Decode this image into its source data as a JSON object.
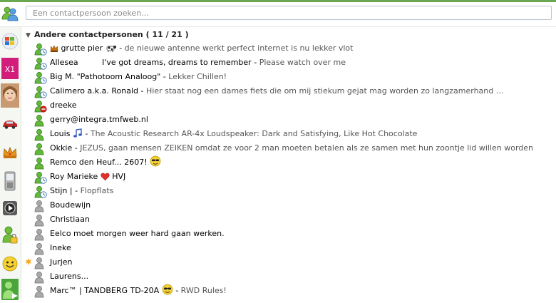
{
  "search": {
    "placeholder": "Een contactpersoon zoeken..."
  },
  "group": {
    "title": "Andere contactpersonen",
    "count": "( 11 / 21 )"
  },
  "sidebar": {
    "items": [
      "windows-logo-icon",
      "x1-icon",
      "user-photo",
      "car-icon",
      "crown-icon",
      "phone-icon",
      "media-play-icon",
      "buddy-lock-icon",
      "smiley-icon",
      "buddy-video-icon"
    ]
  },
  "contacts": [
    {
      "status": "away",
      "pre_icon": "crown",
      "name": "grutte pier",
      "post_icon": "cow",
      "sep": " - ",
      "msg": "de nieuwe antenne werkt perfect internet is nu lekker vlot"
    },
    {
      "status": "away",
      "name": "Allesea",
      "gap": true,
      "name2": "I've got dreams, dreams to remember",
      "sep": " - ",
      "msg": "Please watch over me"
    },
    {
      "status": "away",
      "name": "Big M. \"Pathotoom Analoog\"",
      "sep": " - ",
      "msg": "Lekker Chillen!"
    },
    {
      "status": "away",
      "name": "Calimero a.k.a. Ronald",
      "sep": " - ",
      "msg": "Hier staat nog een dames fiets die om mij stiekum gejat mag worden zo langzamerhand ..."
    },
    {
      "status": "busy",
      "name": "dreeke"
    },
    {
      "status": "online",
      "name": "gerry@integra.tmfweb.nl"
    },
    {
      "status": "online",
      "name": "Louis",
      "post_icon": "note",
      "sep": " - ",
      "msg": "The Acoustic Research AR-4x Loudspeaker: Dark and Satisfying, Like Hot Chocolate"
    },
    {
      "status": "online",
      "name": "Okkie",
      "sep": " - ",
      "msg": "JEZUS, gaan mensen ZEIKEN omdat ze voor 2 man moeten betalen als ze samen met hun zoontje lid willen worden"
    },
    {
      "status": "online",
      "name": "Remco den Heuf...  2607!",
      "post_icon": "cool"
    },
    {
      "status": "away",
      "name": "Roy Marieke",
      "post_icon": "heart",
      "name2": "HVJ"
    },
    {
      "status": "away",
      "name": "Stijn |",
      "sep": " - ",
      "msg": "Flopflats"
    },
    {
      "status": "offline",
      "name": "Boudewijn"
    },
    {
      "status": "offline",
      "name": "Christiaan"
    },
    {
      "status": "offline",
      "name": "Eelco moet morgen weer hard gaan werken."
    },
    {
      "status": "offline",
      "name": "Ineke"
    },
    {
      "status": "offline",
      "star": true,
      "name": "Jurjen"
    },
    {
      "status": "offline",
      "name": "Laurens..."
    },
    {
      "status": "offline",
      "name": "Marc™ | TANDBERG TD-20A",
      "post_icon": "cool",
      "sep": " - ",
      "msg": "RWD Rules!"
    }
  ]
}
